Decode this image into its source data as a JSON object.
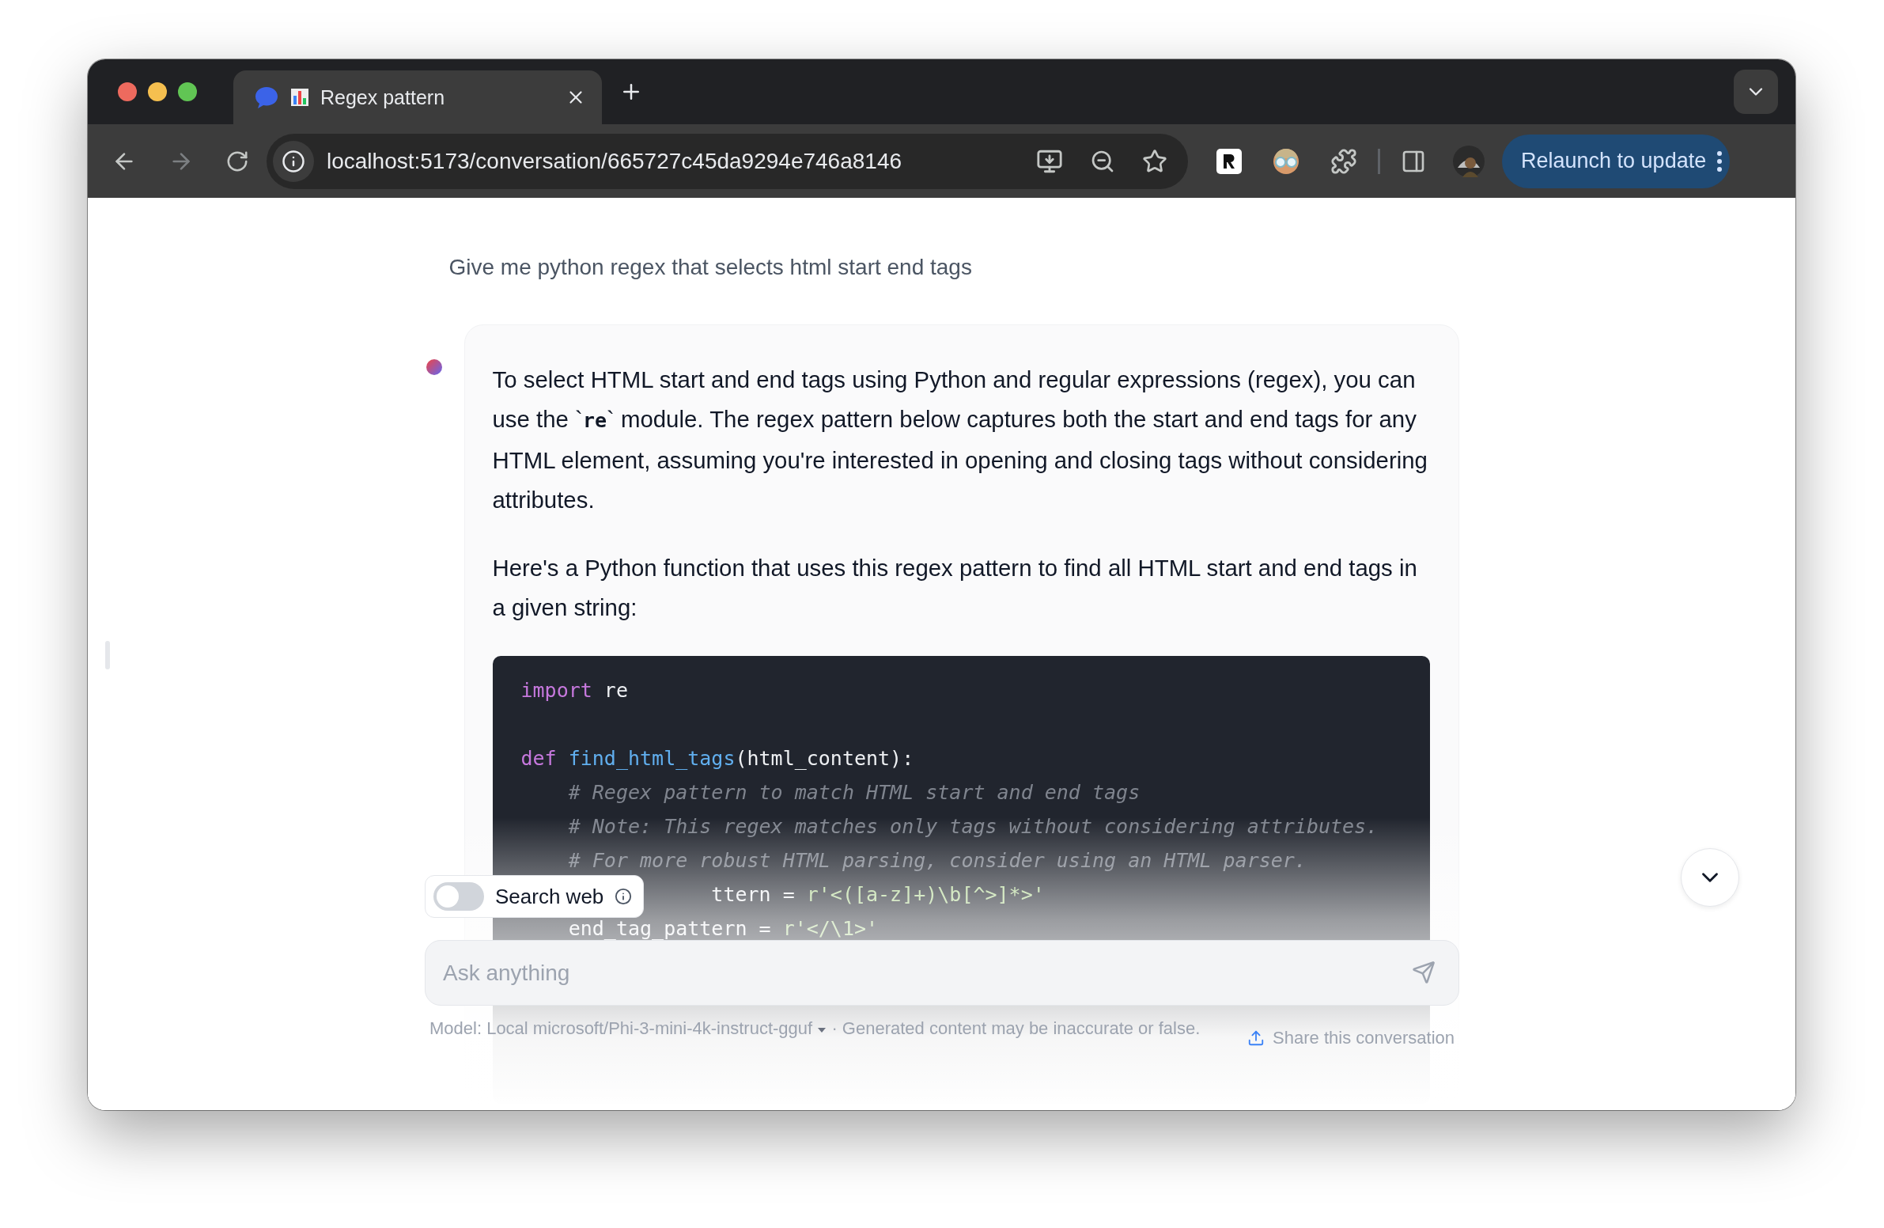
{
  "browser": {
    "tabs": [
      {
        "title": "Regex pattern",
        "selected": true
      }
    ],
    "url": "localhost:5173/conversation/665727c45da9294e746a8146",
    "relaunch_label": "Relaunch to update"
  },
  "conversation": {
    "user_prompt": "Give me python regex that selects html start end tags",
    "assistant": {
      "paragraphs": [
        "To select HTML start and end tags using Python and regular expressions (regex), you can use the `**re**` module. The regex pattern below captures both the start and end tags for any HTML element, assuming you're interested in opening and closing tags without considering attributes.",
        "Here's a Python function that uses this regex pattern to find all HTML start and end tags in a given string:"
      ],
      "code_lines": [
        {
          "kind": "code",
          "tokens": [
            {
              "kind": "keyword",
              "text": "import"
            },
            {
              "kind": "plain",
              "text": " re"
            }
          ]
        },
        {
          "kind": "blank"
        },
        {
          "kind": "code",
          "tokens": [
            {
              "kind": "keyword",
              "text": "def "
            },
            {
              "kind": "function",
              "text": "find_html_tags"
            },
            {
              "kind": "plain",
              "text": "(html_content):"
            }
          ]
        },
        {
          "kind": "code",
          "tokens": [
            {
              "kind": "comment",
              "text": "    # Regex pattern to match HTML start and end tags"
            }
          ]
        },
        {
          "kind": "code",
          "tokens": [
            {
              "kind": "comment",
              "text": "    # Note: This regex matches only tags without considering attributes."
            }
          ]
        },
        {
          "kind": "code",
          "tokens": [
            {
              "kind": "comment",
              "text": "    # For more robust HTML parsing, consider using an HTML parser."
            }
          ]
        },
        {
          "kind": "code",
          "tokens": [
            {
              "kind": "plain",
              "text": "                ttern = "
            },
            {
              "kind": "string",
              "text": "r'<([a-z]+)\\b[^>]*>'"
            }
          ]
        },
        {
          "kind": "code",
          "tokens": [
            {
              "kind": "plain",
              "text": "    end_tag_pattern = "
            },
            {
              "kind": "string",
              "text": "r'</\\1>'"
            }
          ]
        }
      ]
    }
  },
  "composer": {
    "search_web": {
      "label": "Search web",
      "on": false
    },
    "placeholder": "Ask anything",
    "model_text": "Model: Local microsoft/Phi-3-mini-4k-instruct-gguf",
    "disclaimer": "· Generated content may be inaccurate or false.",
    "share_label": "Share this conversation"
  }
}
